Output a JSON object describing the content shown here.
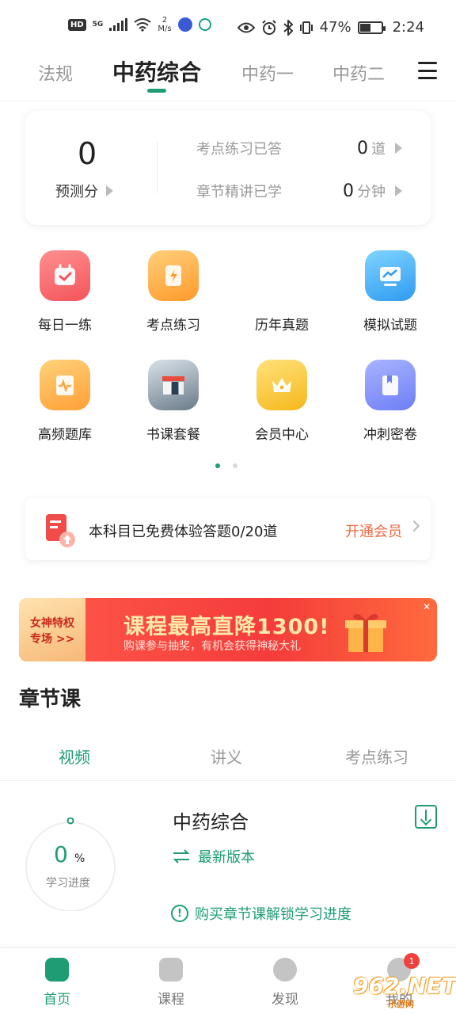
{
  "status_bar": {
    "hd": "HD",
    "network": "5G",
    "speed_value": "2",
    "speed_unit": "M/s",
    "battery": "47%",
    "battery_level": 0.47,
    "time": "2:24"
  },
  "top_tabs": [
    {
      "label": "法规",
      "active": false
    },
    {
      "label": "中药综合",
      "active": true
    },
    {
      "label": "中药一",
      "active": false
    },
    {
      "label": "中药二",
      "active": false
    }
  ],
  "score_card": {
    "score": "0",
    "score_label": "预测分",
    "stats": [
      {
        "label": "考点练习已答",
        "value": "0",
        "unit": "道"
      },
      {
        "label": "章节精讲已学",
        "value": "0",
        "unit": "分钟"
      }
    ]
  },
  "grid": [
    {
      "label": "每日一练",
      "icon": "calendar-check-icon"
    },
    {
      "label": "考点练习",
      "icon": "lightning-card-icon"
    },
    {
      "label": "历年真题",
      "icon": "blank"
    },
    {
      "label": "模拟试题",
      "icon": "monitor-chart-icon"
    },
    {
      "label": "高频题库",
      "icon": "scroll-pulse-icon"
    },
    {
      "label": "书课套餐",
      "icon": "book-bundle-photo"
    },
    {
      "label": "会员中心",
      "icon": "crown-icon"
    },
    {
      "label": "冲刺密卷",
      "icon": "bookmark-book-icon"
    }
  ],
  "trial": {
    "text": "本科目已免费体验答题0/20道",
    "cta": "开通会员"
  },
  "promo": {
    "tag_line1": "女神特权",
    "tag_line2": "专场 >>",
    "title": "课程最高直降1300!",
    "subtitle": "购课参与抽奖，有机会获得神秘大礼"
  },
  "chapter": {
    "title": "章节课",
    "tabs": [
      {
        "label": "视频",
        "active": true
      },
      {
        "label": "讲义",
        "active": false
      },
      {
        "label": "考点练习",
        "active": false
      }
    ],
    "progress_value": "0",
    "progress_unit": "%",
    "progress_label": "学习进度",
    "course_title": "中药综合",
    "version_label": "最新版本",
    "unlock_text": "购买章节课解锁学习进度"
  },
  "bottom_nav": [
    {
      "label": "首页",
      "icon": "home-icon",
      "active": true
    },
    {
      "label": "课程",
      "icon": "course-icon",
      "active": false
    },
    {
      "label": "发现",
      "icon": "compass-icon",
      "active": false
    },
    {
      "label": "我的",
      "icon": "profile-icon",
      "active": false,
      "badge": "1"
    }
  ],
  "watermark": {
    "text": "962.NET",
    "sub": "乐游网"
  },
  "colors": {
    "accent": "#1e9d75",
    "cta": "#f0683f",
    "promo_red": "#f43c3c",
    "badge": "#f0413f"
  }
}
